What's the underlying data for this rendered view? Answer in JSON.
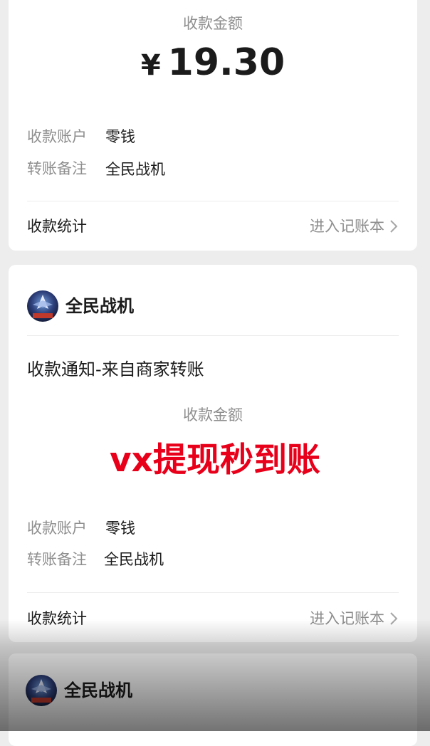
{
  "card1": {
    "amount_label": "收款金额",
    "currency": "¥",
    "amount": "19.30",
    "account_label": "收款账户",
    "account_value": "零钱",
    "remark_label": "转账备注",
    "remark_value": "全民战机",
    "stats_label": "收款统计",
    "ledger_link": "进入记账本"
  },
  "card2": {
    "merchant_name": "全民战机",
    "notice_title": "收款通知-来自商家转账",
    "amount_label": "收款金额",
    "overlay_text": "vx提现秒到账",
    "account_label": "收款账户",
    "account_value": "零钱",
    "remark_label": "转账备注",
    "remark_value": "全民战机",
    "stats_label": "收款统计",
    "ledger_link": "进入记账本"
  },
  "card3": {
    "merchant_name": "全民战机"
  },
  "icons": {
    "chevron": "chevron-right-icon",
    "avatar": "game-avatar-icon"
  },
  "colors": {
    "overlay_red": "#e8001a",
    "background": "#ededed"
  }
}
